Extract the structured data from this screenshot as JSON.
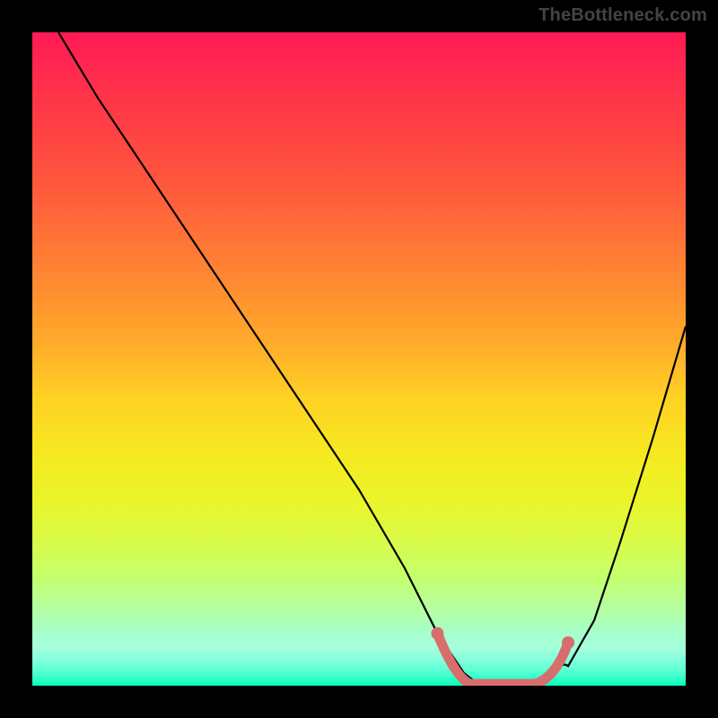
{
  "watermark": "TheBottleneck.com",
  "chart_data": {
    "type": "line",
    "title": "",
    "xlabel": "",
    "ylabel": "",
    "xlim": [
      0,
      100
    ],
    "ylim": [
      0,
      100
    ],
    "grid": false,
    "legend": false,
    "series": [
      {
        "name": "bottleneck-curve",
        "x": [
          4,
          10,
          20,
          30,
          40,
          50,
          57,
          62,
          66,
          70,
          74,
          78,
          82,
          86,
          90,
          95,
          100
        ],
        "y": [
          100,
          90,
          75,
          60,
          45,
          30,
          18,
          8,
          2,
          0,
          0,
          0,
          3,
          10,
          22,
          38,
          55
        ],
        "stroke": "#000000",
        "stroke_width": 2
      }
    ],
    "highlight_segment": {
      "x_start": 62,
      "x_end": 82,
      "y": 0,
      "color": "#d76d6d",
      "width": 10,
      "endpoints": true
    },
    "gradient_stops": [
      {
        "pos": 0.0,
        "color": "#ff1a55"
      },
      {
        "pos": 0.5,
        "color": "#ffd124"
      },
      {
        "pos": 0.8,
        "color": "#d8fb4a"
      },
      {
        "pos": 1.0,
        "color": "#05ffbd"
      }
    ]
  }
}
